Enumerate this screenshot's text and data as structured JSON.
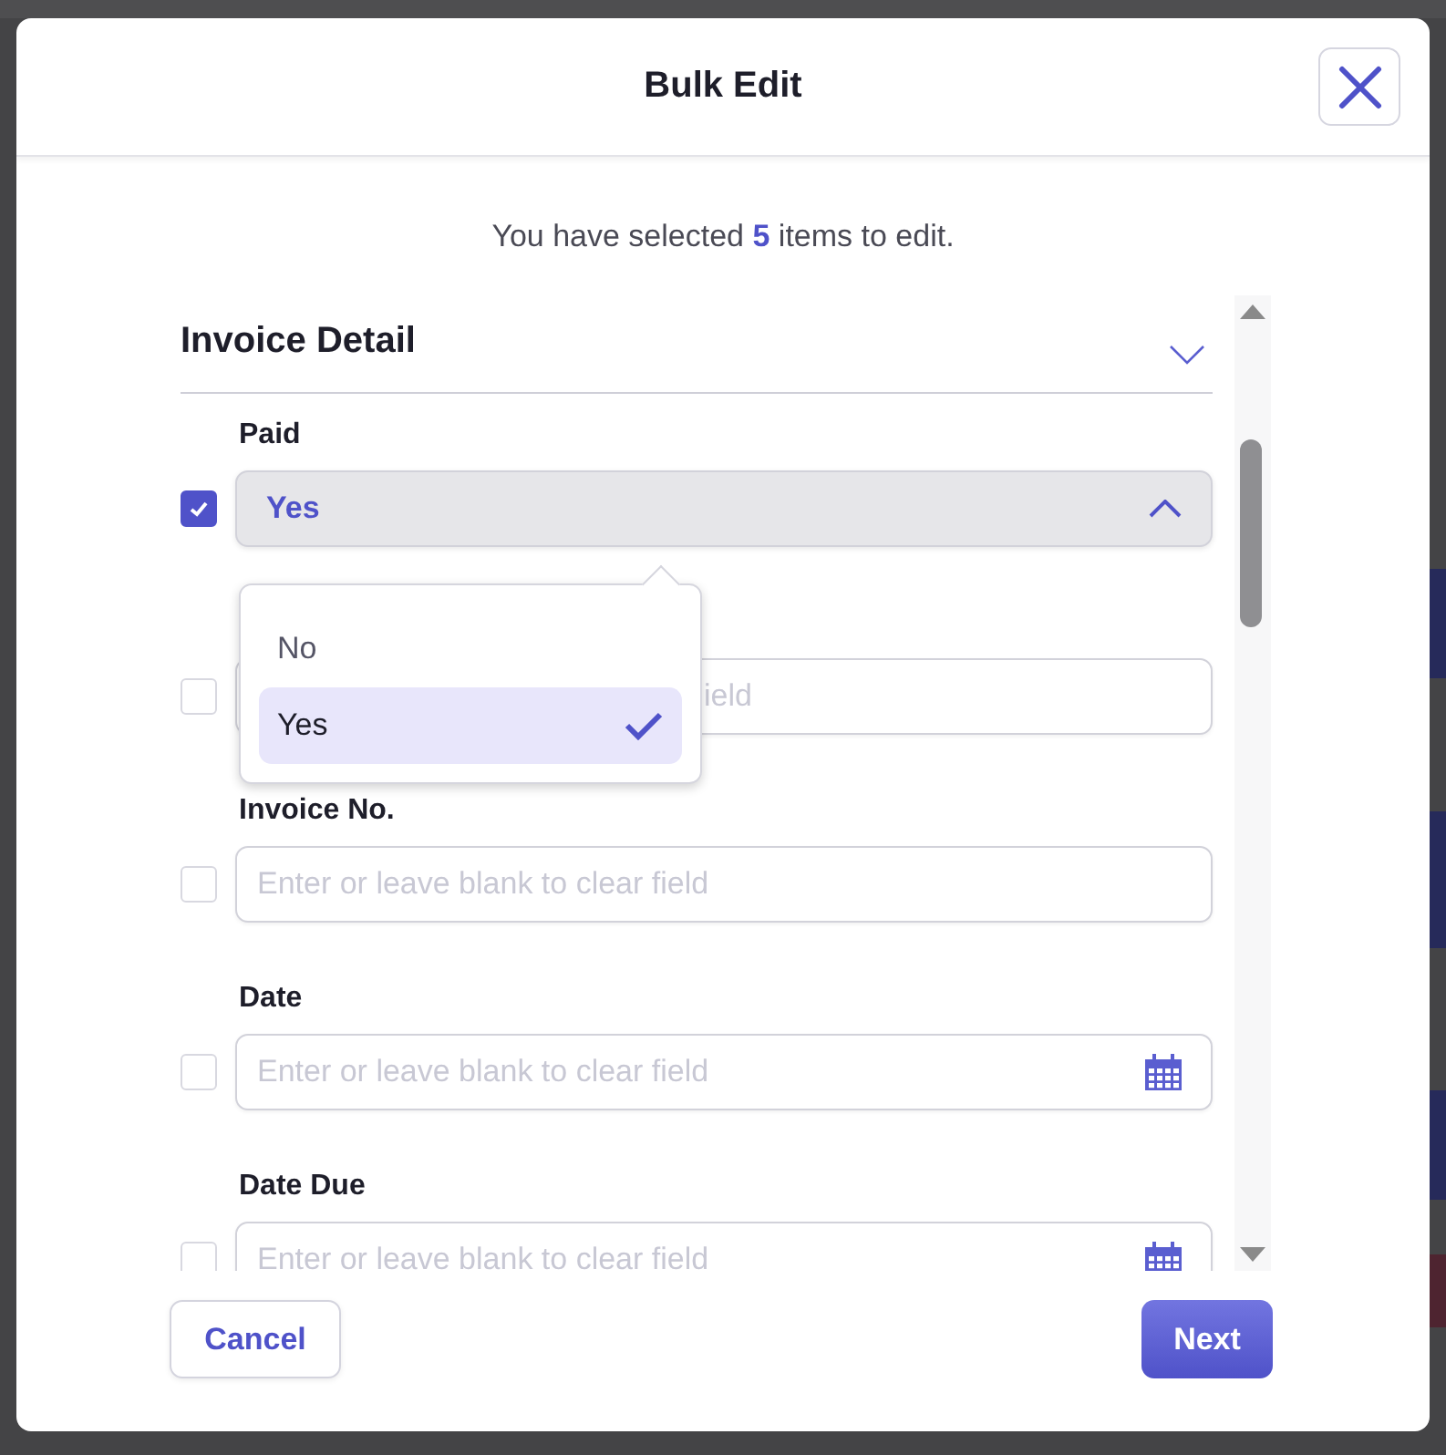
{
  "dialog": {
    "title": "Bulk Edit",
    "selection_note": {
      "before": "You have selected ",
      "count": "5",
      "after": " items to edit."
    },
    "section": {
      "title": "Invoice Detail",
      "expanded": false
    },
    "fields": [
      {
        "kind": "select",
        "label": "Paid",
        "checked": true,
        "value": "Yes",
        "open": true
      },
      {
        "kind": "text",
        "checked": false,
        "placeholder": "ield"
      },
      {
        "kind": "text",
        "label": "Invoice No.",
        "checked": false,
        "placeholder": "Enter or leave blank to clear field"
      },
      {
        "kind": "date",
        "label": "Date",
        "checked": false,
        "placeholder": "Enter or leave blank to clear field"
      },
      {
        "kind": "date",
        "label": "Date Due",
        "checked": false,
        "placeholder": "Enter or leave blank to clear field"
      }
    ],
    "dropdown_options": [
      {
        "label": "No",
        "selected": false
      },
      {
        "label": "Yes",
        "selected": true
      }
    ],
    "buttons": {
      "cancel": "Cancel",
      "next": "Next"
    }
  }
}
